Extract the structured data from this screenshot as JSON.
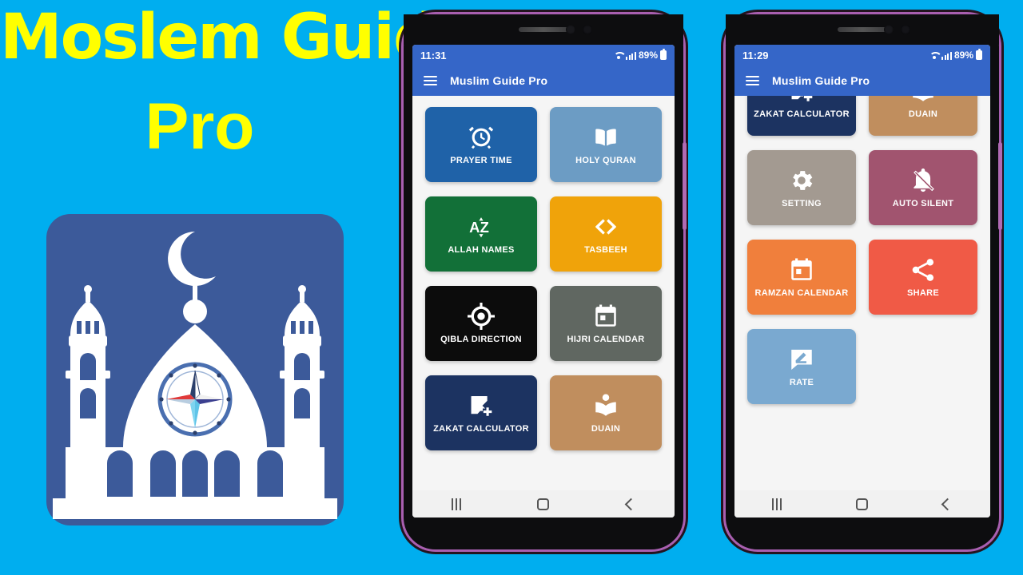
{
  "promo": {
    "title": "Moslem Guide",
    "subtitle": "Pro",
    "title_color": "#FFFF00",
    "background_color": "#00AEEF",
    "logo": {
      "name": "mosque-compass-app-logo",
      "background_color": "#3C5A9A",
      "foreground_color": "#FFFFFF"
    }
  },
  "phones": [
    {
      "id": "phone-left",
      "status": {
        "time": "11:31",
        "battery": "89%",
        "wifi_icon": "wifi-icon",
        "signal_icon": "cellular-signal-icon",
        "battery_icon": "battery-charging-icon"
      },
      "appbar": {
        "menu_icon": "hamburger-menu-icon",
        "title": "Muslim Guide Pro"
      },
      "tiles": [
        {
          "label": "PRAYER TIME",
          "icon": "alarm-clock-icon",
          "color": "#1F62A8"
        },
        {
          "label": "HOLY QURAN",
          "icon": "open-book-icon",
          "color": "#6C9CC4"
        },
        {
          "label": "ALLAH NAMES",
          "icon": "sort-az-icon",
          "color": "#127038"
        },
        {
          "label": "TASBEEH",
          "icon": "code-brackets-icon",
          "color": "#F0A30A"
        },
        {
          "label": "QIBLA DIRECTION",
          "icon": "gps-crosshair-icon",
          "color": "#0C0C0C"
        },
        {
          "label": "HIJRI CALENDAR",
          "icon": "calendar-icon",
          "color": "#606761"
        },
        {
          "label": "ZAKAT CALCULATOR",
          "icon": "calculator-plus-icon",
          "color": "#1C3361"
        },
        {
          "label": "DUAIN",
          "icon": "person-reading-icon",
          "color": "#C08E5E"
        }
      ],
      "navbar": {
        "recents_icon": "recents-icon",
        "home_icon": "home-icon",
        "back_icon": "back-icon"
      }
    },
    {
      "id": "phone-right",
      "status": {
        "time": "11:29",
        "battery": "89%",
        "wifi_icon": "wifi-icon",
        "signal_icon": "cellular-signal-icon",
        "battery_icon": "battery-full-icon"
      },
      "appbar": {
        "menu_icon": "hamburger-menu-icon",
        "title": "Muslim Guide Pro"
      },
      "tiles": [
        {
          "label": "ZAKAT CALCULATOR",
          "icon": "calculator-plus-icon",
          "color": "#1C3361"
        },
        {
          "label": "DUAIN",
          "icon": "person-reading-icon",
          "color": "#C08E5E"
        },
        {
          "label": "SETTING",
          "icon": "gear-icon",
          "color": "#A39A91"
        },
        {
          "label": "AUTO SILENT",
          "icon": "bell-off-icon",
          "color": "#A1546F"
        },
        {
          "label": "RAMZAN CALENDAR",
          "icon": "calendar-icon",
          "color": "#F07F3C"
        },
        {
          "label": "SHARE",
          "icon": "share-nodes-icon",
          "color": "#F05A46"
        },
        {
          "label": "RATE",
          "icon": "rate-review-icon",
          "color": "#7AA9D0"
        }
      ],
      "navbar": {
        "recents_icon": "recents-icon",
        "home_icon": "home-icon",
        "back_icon": "back-icon"
      }
    }
  ]
}
